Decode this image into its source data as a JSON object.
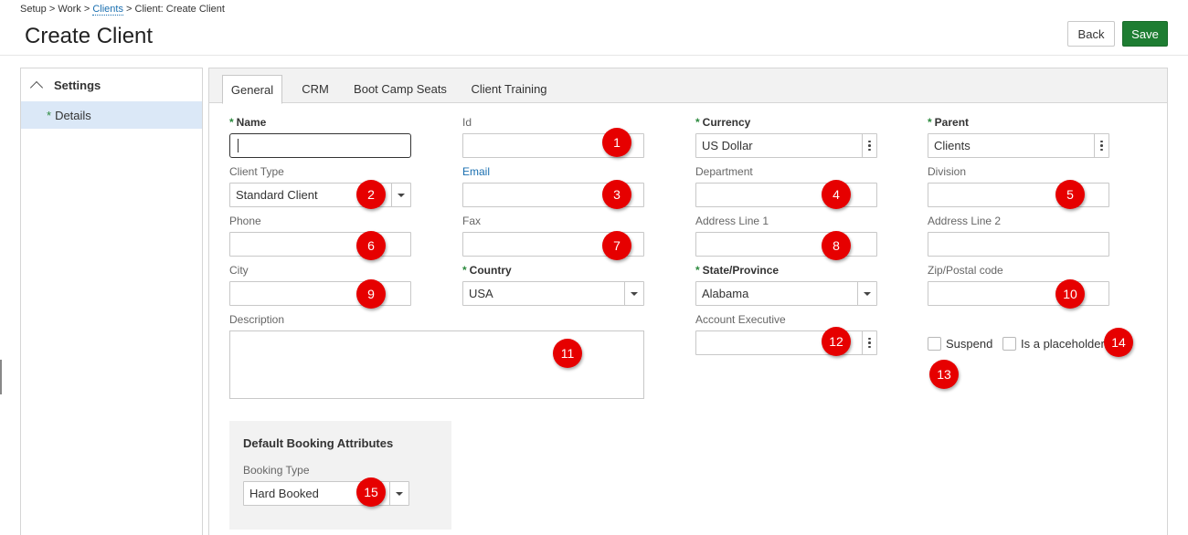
{
  "breadcrumb": {
    "setup": "Setup",
    "sep": ">",
    "work": "Work",
    "clients": "Clients",
    "current": "Client: Create Client"
  },
  "page_title": "Create Client",
  "actions": {
    "back": "Back",
    "save": "Save"
  },
  "sidebar": {
    "section": "Settings",
    "items": [
      {
        "label": "Details",
        "required": "*"
      }
    ]
  },
  "tabs": [
    "General",
    "CRM",
    "Boot Camp Seats",
    "Client Training"
  ],
  "form": {
    "name": {
      "label": "Name",
      "value": ""
    },
    "id": {
      "label": "Id",
      "value": ""
    },
    "currency": {
      "label": "Currency",
      "value": "US Dollar"
    },
    "parent": {
      "label": "Parent",
      "value": "Clients"
    },
    "client_type": {
      "label": "Client Type",
      "value": "Standard Client"
    },
    "email": {
      "label": "Email",
      "value": ""
    },
    "department": {
      "label": "Department",
      "value": ""
    },
    "division": {
      "label": "Division",
      "value": ""
    },
    "phone": {
      "label": "Phone",
      "value": ""
    },
    "fax": {
      "label": "Fax",
      "value": ""
    },
    "address1": {
      "label": "Address Line 1",
      "value": ""
    },
    "address2": {
      "label": "Address Line 2",
      "value": ""
    },
    "city": {
      "label": "City",
      "value": ""
    },
    "country": {
      "label": "Country",
      "value": "USA"
    },
    "state": {
      "label": "State/Province",
      "value": "Alabama"
    },
    "zip": {
      "label": "Zip/Postal code",
      "value": ""
    },
    "description": {
      "label": "Description",
      "value": ""
    },
    "account_exec": {
      "label": "Account Executive",
      "value": ""
    },
    "suspend": {
      "label": "Suspend"
    },
    "placeholder": {
      "label": "Is a placeholder"
    }
  },
  "required_marker": "*",
  "booking": {
    "title": "Default Booking Attributes",
    "type_label": "Booking Type",
    "type_value": "Hard Booked"
  },
  "badges": [
    "1",
    "2",
    "3",
    "4",
    "5",
    "6",
    "7",
    "8",
    "9",
    "10",
    "11",
    "12",
    "13",
    "14",
    "15"
  ],
  "colors": {
    "save": "#1e7d32",
    "badge": "#e60000",
    "required": "#2c8a3e",
    "link": "#1a6fb0",
    "sidebar_selected": "#dbe8f7"
  }
}
